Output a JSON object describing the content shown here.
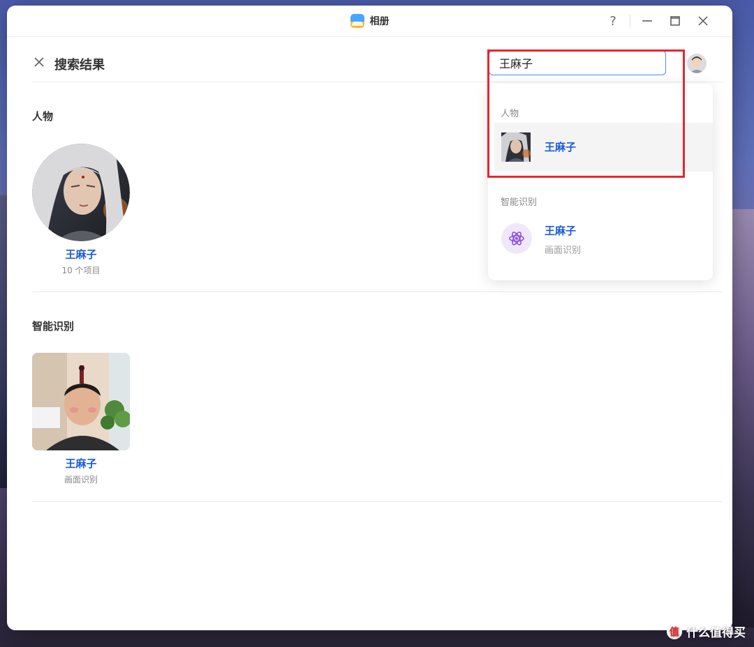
{
  "window": {
    "title": "相册"
  },
  "header": {
    "title": "搜索结果"
  },
  "search": {
    "value": "王麻子"
  },
  "sections": {
    "people": {
      "title": "人物",
      "card_name": "王麻子",
      "card_sub": "10 个项目"
    },
    "ai": {
      "title": "智能识别",
      "card_name": "王麻子",
      "card_sub": "画面识别"
    }
  },
  "dropdown": {
    "group_people": "人物",
    "person_name": "王麻子",
    "group_ai": "智能识别",
    "ai_name": "王麻子",
    "ai_sub": "画面识别"
  },
  "watermark": {
    "badge": "值",
    "text": "什么值得买"
  },
  "colors": {
    "accent_blue": "#1a5bd8",
    "highlight_red": "#e8262d",
    "search_border": "#4c8bf5"
  },
  "icons": {
    "app": "photos-app-icon",
    "help": "help-icon",
    "minimize": "minimize-icon",
    "maximize": "maximize-icon",
    "close": "close-icon",
    "atom": "atom-icon"
  }
}
